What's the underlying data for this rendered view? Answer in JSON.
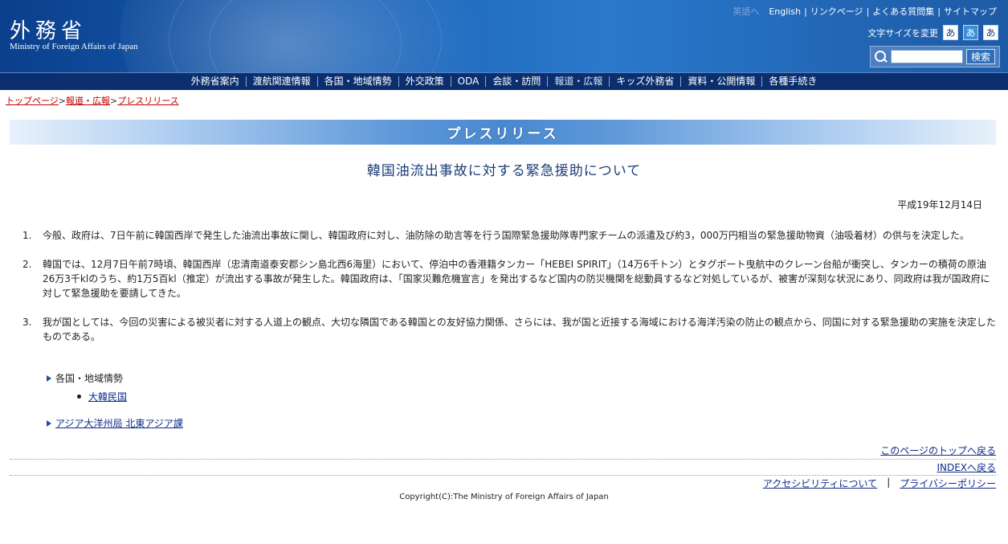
{
  "header": {
    "logo_kanji": "外務省",
    "logo_en": "Ministry of Foreign Affairs of Japan",
    "top_links": {
      "dim_label": "英語へ",
      "english": "English",
      "link_page": "リンクページ",
      "faq": "よくある質問集",
      "sitemap": "サイトマップ"
    },
    "font_size_label": "文字サイズを変更",
    "font_sizes": [
      "あ",
      "あ",
      "あ"
    ],
    "search_button": "検索",
    "search_placeholder": ""
  },
  "nav": [
    "外務省案内",
    "渡航関連情報",
    "各国・地域情勢",
    "外交政策",
    "ODA",
    "会談・訪問",
    "報道・広報",
    "キッズ外務省",
    "資料・公開情報",
    "各種手続き"
  ],
  "breadcrumb": {
    "home": "トップページ",
    "sep1": ">",
    "press": "報道・広報",
    "sep2": ">",
    "current": "プレスリリース"
  },
  "banner": "プレスリリース",
  "page_title": "韓国油流出事故に対する緊急援助について",
  "date": "平成19年12月14日",
  "paragraphs": [
    {
      "num": "1.",
      "text": "今般、政府は、7日午前に韓国西岸で発生した油流出事故に関し、韓国政府に対し、油防除の助言等を行う国際緊急援助隊専門家チームの派遣及び約3，000万円相当の緊急援助物資（油吸着材）の供与を決定した。"
    },
    {
      "num": "2.",
      "text": "韓国では、12月7日午前7時頃、韓国西岸（忠清南道泰安郡シン島北西6海里）において、停泊中の香港籍タンカー「HEBEI SPIRIT」（14万6千トン）とタグボート曳航中のクレーン台船が衝突し、タンカーの積荷の原油26万3千klのうち、約1万5百kl（推定）が流出する事故が発生した。韓国政府は、「国家災難危機宣言」を発出するなど国内の防災機関を総動員するなど対処しているが、被害が深刻な状況にあり、同政府は我が国政府に対して緊急援助を要請してきた。"
    },
    {
      "num": "3.",
      "text": "我が国としては、今回の災害による被災者に対する人道上の観点、大切な隣国である韓国との友好協力関係、さらには、我が国と近接する海域における海洋汚染の防止の観点から、同国に対する緊急援助の実施を決定したものである。"
    }
  ],
  "related": {
    "heading": "各国・地域情勢",
    "link": "大韓民国"
  },
  "bureau": "アジア大洋州局 北東アジア課",
  "footer": {
    "back_to_top": "このページのトップへ戻る",
    "index": "INDEXへ戻る",
    "accessibility": "アクセシビリティについて",
    "separator": "|",
    "privacy": "プライバシーポリシー",
    "copyright": "Copyright(C):The Ministry of Foreign Affairs of Japan"
  }
}
